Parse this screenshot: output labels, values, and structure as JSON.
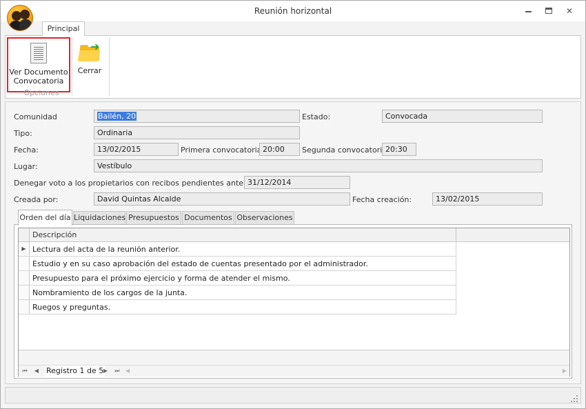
{
  "window": {
    "title": "Reunión horizontal",
    "controls": {
      "minimize": "minimize",
      "maximize": "maximize",
      "close": "✕"
    }
  },
  "ribbon": {
    "tab_label": "Principal",
    "buttons": {
      "ver_documento": {
        "line1": "Ver Documento",
        "line2": "Convocatoria",
        "icon": "document-icon"
      },
      "cerrar": {
        "label": "Cerrar",
        "icon": "folder-exit-icon"
      }
    },
    "group_label": "Opciones"
  },
  "form": {
    "comunidad": {
      "label": "Comunidad",
      "value": "Bailén, 20"
    },
    "estado": {
      "label": "Estado:",
      "value": "Convocada"
    },
    "tipo": {
      "label": "Tipo:",
      "value": "Ordinaria"
    },
    "fecha": {
      "label": "Fecha:",
      "value": "13/02/2015"
    },
    "primera": {
      "label": "Primera convocatoria:",
      "value": "20:00"
    },
    "segunda": {
      "label": "Segunda convocatoria:",
      "value": "20:30"
    },
    "lugar": {
      "label": "Lugar:",
      "value": "Vestíbulo"
    },
    "denegar": {
      "label": "Denegar voto a los propietarios con recibos pendientes anteriores a:",
      "value": "31/12/2014"
    },
    "creada_por": {
      "label": "Creada por:",
      "value": "David Quintas Alcalde"
    },
    "fecha_creacion": {
      "label": "Fecha creación:",
      "value": "13/02/2015"
    }
  },
  "tabs": [
    {
      "label": "Orden del día",
      "active": true
    },
    {
      "label": "Liquidaciones",
      "active": false
    },
    {
      "label": "Presupuestos",
      "active": false
    },
    {
      "label": "Documentos",
      "active": false
    },
    {
      "label": "Observaciones",
      "active": false
    }
  ],
  "grid": {
    "column": "Descripción",
    "current_row_marker": "▶",
    "rows": [
      "Lectura del acta de la reunión anterior.",
      "Estudio y en su caso aprobación del estado de cuentas presentado por el administrador.",
      "Presupuesto para el próximo ejercicio y forma de atender el mismo.",
      "Nombramiento de los cargos de la junta.",
      "Ruegos y preguntas."
    ],
    "navigator": {
      "first": "⏮",
      "prev": "◀",
      "record_text": "Registro 1 de 5",
      "next": "▶",
      "last": "⏭",
      "scroll_left": "◀",
      "scroll_right": "▶"
    }
  },
  "colors": {
    "selection": "#3c7be0",
    "highlight_border": "#e8202a"
  }
}
